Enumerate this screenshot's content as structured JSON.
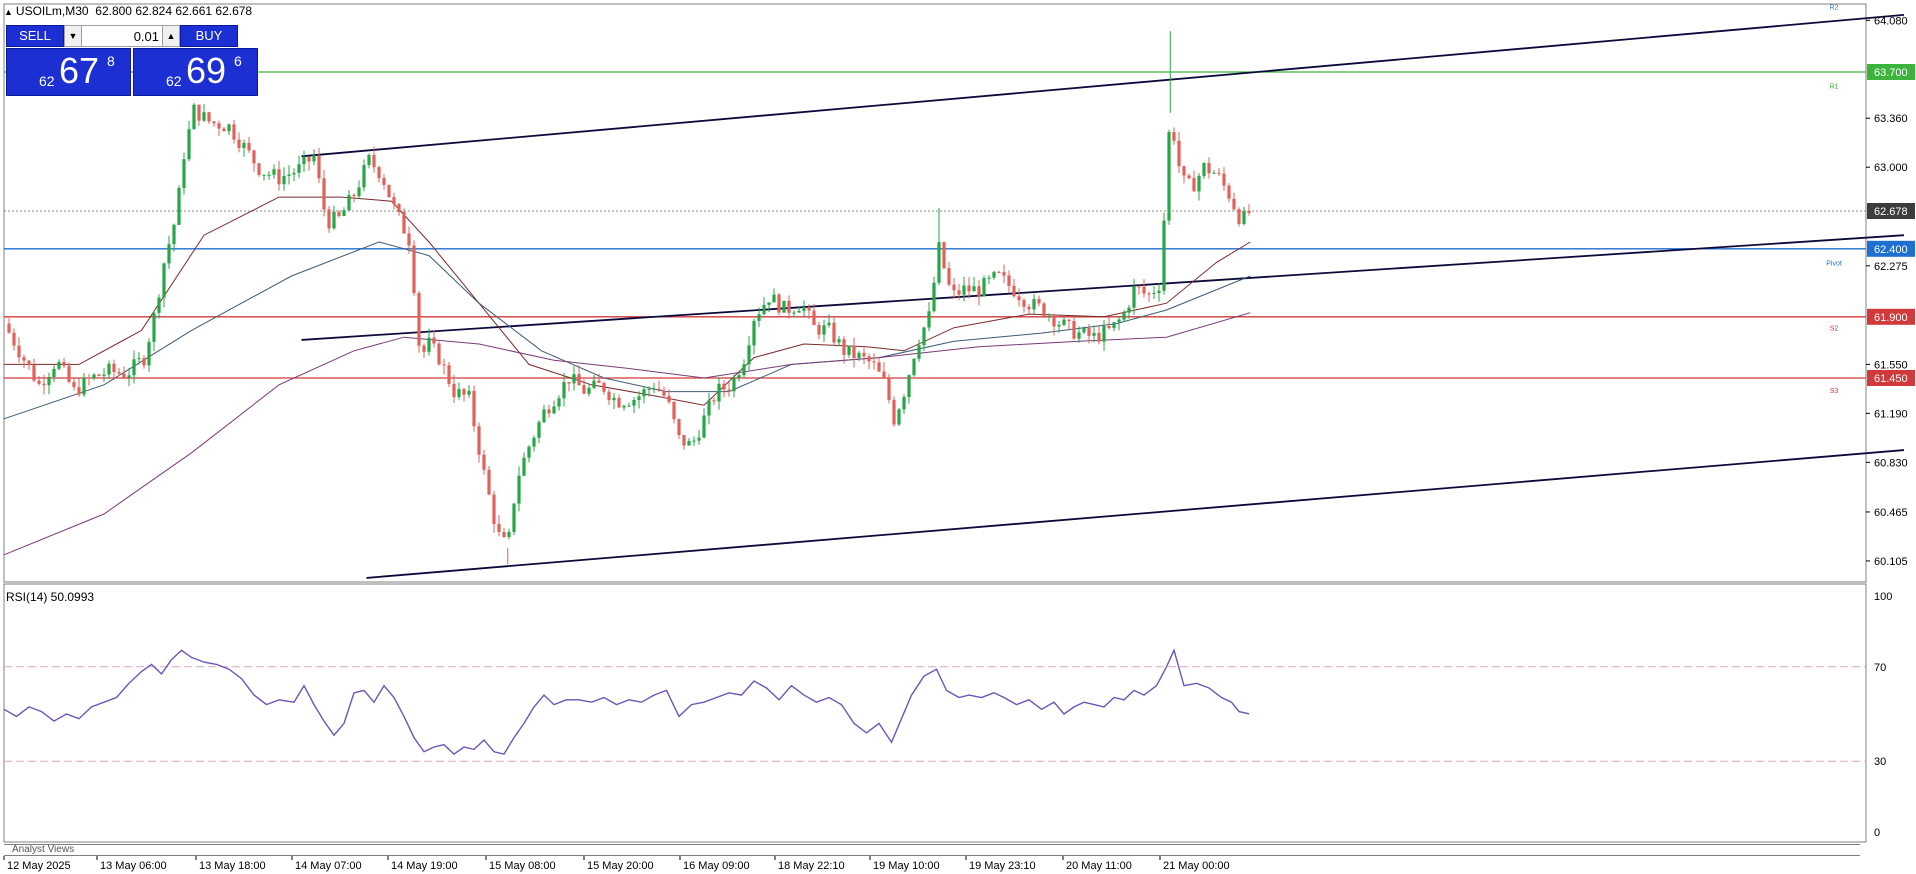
{
  "header": {
    "symbol": "USOILm,M30",
    "ohlc": "62.800 62.824 62.661 62.678"
  },
  "trade_panel": {
    "sell_label": "SELL",
    "buy_label": "BUY",
    "volume": "0.01",
    "sell_price": {
      "small": "62",
      "big": "67",
      "sup": "8"
    },
    "buy_price": {
      "small": "62",
      "big": "69",
      "sup": "6"
    }
  },
  "price_axis": {
    "ticks": [
      "64.080",
      "63.360",
      "63.000",
      "62.275",
      "61.550",
      "61.190",
      "60.830",
      "60.465",
      "60.105"
    ],
    "tick_values": [
      64.08,
      63.36,
      63.0,
      62.275,
      61.55,
      61.19,
      60.83,
      60.465,
      60.105
    ],
    "ylim": [
      59.95,
      64.2
    ]
  },
  "levels": [
    {
      "name": "R1",
      "value": 63.7,
      "label": "63.700",
      "color": "#3cb43c"
    },
    {
      "name": "Pivot",
      "value": 62.4,
      "label": "62.400",
      "color": "#1e6fd0"
    },
    {
      "name": "S2",
      "value": 61.9,
      "label": "61.900",
      "color": "#d03a3a"
    },
    {
      "name": "S3",
      "value": 61.45,
      "label": "61.450",
      "color": "#d03a3a"
    }
  ],
  "level_names": {
    "r2": "R2",
    "r1": "R1",
    "pivot": "Pivot",
    "s2": "S2",
    "s3": "S3"
  },
  "current_price": {
    "value": 62.678,
    "label": "62.678"
  },
  "time_axis": [
    "12 May 2025",
    "13 May 06:00",
    "13 May 18:00",
    "14 May 07:00",
    "14 May 19:00",
    "15 May 08:00",
    "15 May 20:00",
    "16 May 09:00",
    "18 May 22:10",
    "19 May 10:00",
    "19 May 23:10",
    "20 May 11:00",
    "21 May 00:00"
  ],
  "rsi": {
    "label": "RSI(14) 50.0993",
    "axis": [
      "100",
      "70",
      "30",
      "0"
    ],
    "levels": [
      70,
      30
    ],
    "color": "#6b56b8"
  },
  "analyst_views_label": "Analyst Views",
  "chart_data": {
    "type": "candlestick",
    "symbol": "USOILm",
    "timeframe": "M30",
    "price_points": [
      [
        0,
        61.85
      ],
      [
        14,
        61.62
      ],
      [
        28,
        61.4
      ],
      [
        42,
        61.58
      ],
      [
        56,
        61.35
      ],
      [
        70,
        61.45
      ],
      [
        84,
        61.5
      ],
      [
        98,
        61.48
      ],
      [
        112,
        61.6
      ],
      [
        120,
        61.9
      ],
      [
        128,
        62.3
      ],
      [
        138,
        62.65
      ],
      [
        144,
        63.1
      ],
      [
        152,
        63.42
      ],
      [
        165,
        63.33
      ],
      [
        180,
        63.3
      ],
      [
        192,
        63.15
      ],
      [
        205,
        62.98
      ],
      [
        220,
        62.92
      ],
      [
        235,
        62.98
      ],
      [
        248,
        63.08
      ],
      [
        258,
        62.6
      ],
      [
        268,
        62.62
      ],
      [
        280,
        62.8
      ],
      [
        292,
        63.05
      ],
      [
        302,
        62.95
      ],
      [
        312,
        62.7
      ],
      [
        325,
        62.45
      ],
      [
        333,
        61.6
      ],
      [
        340,
        61.7
      ],
      [
        348,
        61.6
      ],
      [
        360,
        61.35
      ],
      [
        372,
        61.3
      ],
      [
        385,
        60.7
      ],
      [
        395,
        60.3
      ],
      [
        403,
        60.2
      ],
      [
        410,
        60.7
      ],
      [
        420,
        60.95
      ],
      [
        432,
        61.2
      ],
      [
        440,
        61.3
      ],
      [
        452,
        61.45
      ],
      [
        465,
        61.35
      ],
      [
        478,
        61.4
      ],
      [
        490,
        61.28
      ],
      [
        505,
        61.3
      ],
      [
        520,
        61.4
      ],
      [
        530,
        61.3
      ],
      [
        540,
        61.0
      ],
      [
        550,
        60.95
      ],
      [
        560,
        61.15
      ],
      [
        570,
        61.35
      ],
      [
        582,
        61.4
      ],
      [
        592,
        61.6
      ],
      [
        600,
        61.9
      ],
      [
        612,
        62.05
      ],
      [
        625,
        61.95
      ],
      [
        638,
        62.0
      ],
      [
        648,
        61.82
      ],
      [
        660,
        61.8
      ],
      [
        672,
        61.65
      ],
      [
        685,
        61.6
      ],
      [
        695,
        61.55
      ],
      [
        705,
        61.4
      ],
      [
        712,
        61.15
      ],
      [
        720,
        61.35
      ],
      [
        730,
        61.7
      ],
      [
        740,
        61.9
      ],
      [
        748,
        62.4
      ],
      [
        758,
        62.05
      ],
      [
        768,
        62.1
      ],
      [
        780,
        62.1
      ],
      [
        795,
        62.2
      ],
      [
        808,
        62.1
      ],
      [
        820,
        62.0
      ],
      [
        832,
        61.95
      ],
      [
        845,
        61.85
      ],
      [
        858,
        61.78
      ],
      [
        872,
        61.75
      ],
      [
        885,
        61.8
      ],
      [
        895,
        61.9
      ],
      [
        905,
        62.12
      ],
      [
        915,
        62.05
      ],
      [
        925,
        62.15
      ],
      [
        933,
        63.4
      ],
      [
        942,
        62.9
      ],
      [
        950,
        62.85
      ],
      [
        960,
        63.0
      ],
      [
        970,
        62.95
      ],
      [
        980,
        62.8
      ],
      [
        990,
        62.6
      ],
      [
        997,
        62.678
      ]
    ],
    "wick_extremes": [
      {
        "x": 933,
        "high": 64.0
      },
      {
        "x": 403,
        "low": 60.08
      },
      {
        "x": 748,
        "high": 62.7
      }
    ],
    "moving_averages": [
      {
        "name": "MA fast",
        "color": "#7a2a2a",
        "points": [
          [
            0,
            61.55
          ],
          [
            60,
            61.55
          ],
          [
            110,
            61.8
          ],
          [
            160,
            62.5
          ],
          [
            220,
            62.78
          ],
          [
            270,
            62.78
          ],
          [
            310,
            62.75
          ],
          [
            340,
            62.45
          ],
          [
            380,
            62.0
          ],
          [
            420,
            61.55
          ],
          [
            470,
            61.4
          ],
          [
            520,
            61.32
          ],
          [
            560,
            61.25
          ],
          [
            600,
            61.6
          ],
          [
            640,
            61.7
          ],
          [
            690,
            61.68
          ],
          [
            720,
            61.65
          ],
          [
            760,
            61.82
          ],
          [
            820,
            61.92
          ],
          [
            880,
            61.9
          ],
          [
            930,
            62.0
          ],
          [
            970,
            62.3
          ],
          [
            997,
            62.45
          ]
        ]
      },
      {
        "name": "MA mid",
        "color": "#3c5a78",
        "points": [
          [
            0,
            61.15
          ],
          [
            80,
            61.4
          ],
          [
            150,
            61.8
          ],
          [
            230,
            62.2
          ],
          [
            300,
            62.45
          ],
          [
            340,
            62.35
          ],
          [
            380,
            62.0
          ],
          [
            430,
            61.65
          ],
          [
            480,
            61.45
          ],
          [
            530,
            61.35
          ],
          [
            580,
            61.35
          ],
          [
            630,
            61.55
          ],
          [
            700,
            61.6
          ],
          [
            760,
            61.72
          ],
          [
            830,
            61.78
          ],
          [
            890,
            61.85
          ],
          [
            930,
            61.95
          ],
          [
            997,
            62.2
          ]
        ]
      },
      {
        "name": "MA slow",
        "color": "#7a3a7a",
        "points": [
          [
            0,
            60.15
          ],
          [
            80,
            60.45
          ],
          [
            150,
            60.9
          ],
          [
            220,
            61.4
          ],
          [
            280,
            61.65
          ],
          [
            320,
            61.75
          ],
          [
            380,
            61.7
          ],
          [
            440,
            61.58
          ],
          [
            500,
            61.52
          ],
          [
            560,
            61.45
          ],
          [
            630,
            61.55
          ],
          [
            700,
            61.6
          ],
          [
            780,
            61.68
          ],
          [
            860,
            61.72
          ],
          [
            930,
            61.75
          ],
          [
            997,
            61.93
          ]
        ]
      }
    ],
    "trendlines": [
      {
        "from": [
          238,
          63.08
        ],
        "to": [
          1520,
          64.12
        ]
      },
      {
        "from": [
          238,
          61.73
        ],
        "to": [
          1520,
          62.5
        ]
      },
      {
        "from": [
          290,
          59.98
        ],
        "to": [
          1520,
          60.92
        ]
      }
    ],
    "rsi_points": [
      [
        0,
        52
      ],
      [
        10,
        49
      ],
      [
        20,
        53
      ],
      [
        30,
        51
      ],
      [
        40,
        47
      ],
      [
        50,
        50
      ],
      [
        60,
        48
      ],
      [
        70,
        53
      ],
      [
        80,
        55
      ],
      [
        90,
        57
      ],
      [
        100,
        63
      ],
      [
        110,
        68
      ],
      [
        118,
        71
      ],
      [
        126,
        67
      ],
      [
        134,
        73
      ],
      [
        142,
        77
      ],
      [
        150,
        74
      ],
      [
        160,
        72
      ],
      [
        170,
        71
      ],
      [
        180,
        69
      ],
      [
        190,
        65
      ],
      [
        200,
        58
      ],
      [
        210,
        54
      ],
      [
        220,
        56
      ],
      [
        232,
        55
      ],
      [
        240,
        62
      ],
      [
        248,
        54
      ],
      [
        256,
        47
      ],
      [
        264,
        41
      ],
      [
        272,
        46
      ],
      [
        280,
        59
      ],
      [
        288,
        60
      ],
      [
        296,
        55
      ],
      [
        304,
        62
      ],
      [
        312,
        57
      ],
      [
        320,
        49
      ],
      [
        328,
        40
      ],
      [
        336,
        34
      ],
      [
        344,
        36
      ],
      [
        352,
        37
      ],
      [
        360,
        33
      ],
      [
        368,
        36
      ],
      [
        376,
        35
      ],
      [
        384,
        39
      ],
      [
        392,
        34
      ],
      [
        400,
        33
      ],
      [
        408,
        40
      ],
      [
        416,
        46
      ],
      [
        424,
        53
      ],
      [
        432,
        58
      ],
      [
        440,
        54
      ],
      [
        450,
        56
      ],
      [
        460,
        56
      ],
      [
        470,
        55
      ],
      [
        480,
        57
      ],
      [
        490,
        54
      ],
      [
        500,
        56
      ],
      [
        510,
        55
      ],
      [
        520,
        58
      ],
      [
        530,
        60
      ],
      [
        540,
        49
      ],
      [
        550,
        54
      ],
      [
        560,
        55
      ],
      [
        570,
        57
      ],
      [
        580,
        59
      ],
      [
        590,
        58
      ],
      [
        600,
        64
      ],
      [
        610,
        61
      ],
      [
        620,
        56
      ],
      [
        630,
        62
      ],
      [
        640,
        58
      ],
      [
        650,
        55
      ],
      [
        660,
        57
      ],
      [
        670,
        54
      ],
      [
        680,
        46
      ],
      [
        690,
        42
      ],
      [
        700,
        46
      ],
      [
        710,
        38
      ],
      [
        718,
        48
      ],
      [
        726,
        58
      ],
      [
        736,
        66
      ],
      [
        746,
        69
      ],
      [
        754,
        60
      ],
      [
        764,
        57
      ],
      [
        772,
        58
      ],
      [
        782,
        57
      ],
      [
        792,
        59
      ],
      [
        800,
        57
      ],
      [
        810,
        54
      ],
      [
        820,
        56
      ],
      [
        830,
        52
      ],
      [
        840,
        55
      ],
      [
        848,
        50
      ],
      [
        856,
        53
      ],
      [
        864,
        55
      ],
      [
        872,
        54
      ],
      [
        880,
        53
      ],
      [
        888,
        57
      ],
      [
        896,
        56
      ],
      [
        904,
        60
      ],
      [
        912,
        58
      ],
      [
        922,
        62
      ],
      [
        930,
        70
      ],
      [
        936,
        77
      ],
      [
        944,
        62
      ],
      [
        954,
        63
      ],
      [
        964,
        61
      ],
      [
        974,
        57
      ],
      [
        982,
        55
      ],
      [
        988,
        51
      ],
      [
        996,
        50.1
      ]
    ]
  }
}
